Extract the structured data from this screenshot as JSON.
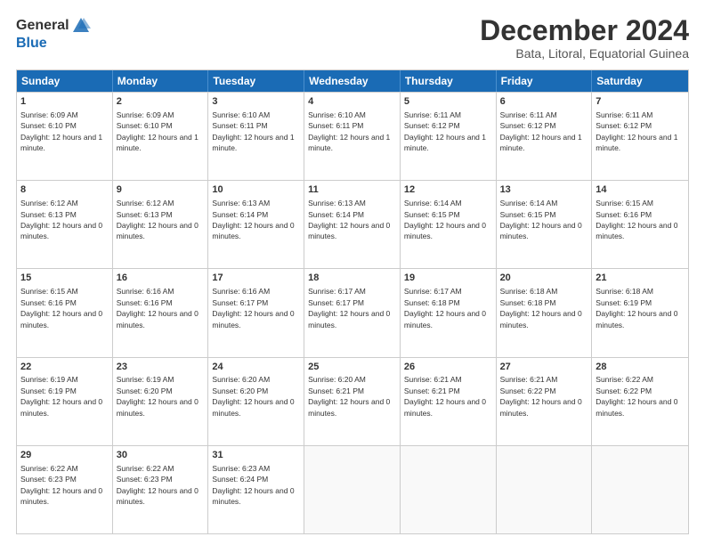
{
  "logo": {
    "general": "General",
    "blue": "Blue"
  },
  "title": "December 2024",
  "subtitle": "Bata, Litoral, Equatorial Guinea",
  "days": [
    "Sunday",
    "Monday",
    "Tuesday",
    "Wednesday",
    "Thursday",
    "Friday",
    "Saturday"
  ],
  "weeks": [
    [
      {
        "day": "1",
        "rise": "6:09 AM",
        "set": "6:10 PM",
        "daylight": "12 hours and 1 minute."
      },
      {
        "day": "2",
        "rise": "6:09 AM",
        "set": "6:10 PM",
        "daylight": "12 hours and 1 minute."
      },
      {
        "day": "3",
        "rise": "6:10 AM",
        "set": "6:11 PM",
        "daylight": "12 hours and 1 minute."
      },
      {
        "day": "4",
        "rise": "6:10 AM",
        "set": "6:11 PM",
        "daylight": "12 hours and 1 minute."
      },
      {
        "day": "5",
        "rise": "6:11 AM",
        "set": "6:12 PM",
        "daylight": "12 hours and 1 minute."
      },
      {
        "day": "6",
        "rise": "6:11 AM",
        "set": "6:12 PM",
        "daylight": "12 hours and 1 minute."
      },
      {
        "day": "7",
        "rise": "6:11 AM",
        "set": "6:12 PM",
        "daylight": "12 hours and 1 minute."
      }
    ],
    [
      {
        "day": "8",
        "rise": "6:12 AM",
        "set": "6:13 PM",
        "daylight": "12 hours and 0 minutes."
      },
      {
        "day": "9",
        "rise": "6:12 AM",
        "set": "6:13 PM",
        "daylight": "12 hours and 0 minutes."
      },
      {
        "day": "10",
        "rise": "6:13 AM",
        "set": "6:14 PM",
        "daylight": "12 hours and 0 minutes."
      },
      {
        "day": "11",
        "rise": "6:13 AM",
        "set": "6:14 PM",
        "daylight": "12 hours and 0 minutes."
      },
      {
        "day": "12",
        "rise": "6:14 AM",
        "set": "6:15 PM",
        "daylight": "12 hours and 0 minutes."
      },
      {
        "day": "13",
        "rise": "6:14 AM",
        "set": "6:15 PM",
        "daylight": "12 hours and 0 minutes."
      },
      {
        "day": "14",
        "rise": "6:15 AM",
        "set": "6:16 PM",
        "daylight": "12 hours and 0 minutes."
      }
    ],
    [
      {
        "day": "15",
        "rise": "6:15 AM",
        "set": "6:16 PM",
        "daylight": "12 hours and 0 minutes."
      },
      {
        "day": "16",
        "rise": "6:16 AM",
        "set": "6:16 PM",
        "daylight": "12 hours and 0 minutes."
      },
      {
        "day": "17",
        "rise": "6:16 AM",
        "set": "6:17 PM",
        "daylight": "12 hours and 0 minutes."
      },
      {
        "day": "18",
        "rise": "6:17 AM",
        "set": "6:17 PM",
        "daylight": "12 hours and 0 minutes."
      },
      {
        "day": "19",
        "rise": "6:17 AM",
        "set": "6:18 PM",
        "daylight": "12 hours and 0 minutes."
      },
      {
        "day": "20",
        "rise": "6:18 AM",
        "set": "6:18 PM",
        "daylight": "12 hours and 0 minutes."
      },
      {
        "day": "21",
        "rise": "6:18 AM",
        "set": "6:19 PM",
        "daylight": "12 hours and 0 minutes."
      }
    ],
    [
      {
        "day": "22",
        "rise": "6:19 AM",
        "set": "6:19 PM",
        "daylight": "12 hours and 0 minutes."
      },
      {
        "day": "23",
        "rise": "6:19 AM",
        "set": "6:20 PM",
        "daylight": "12 hours and 0 minutes."
      },
      {
        "day": "24",
        "rise": "6:20 AM",
        "set": "6:20 PM",
        "daylight": "12 hours and 0 minutes."
      },
      {
        "day": "25",
        "rise": "6:20 AM",
        "set": "6:21 PM",
        "daylight": "12 hours and 0 minutes."
      },
      {
        "day": "26",
        "rise": "6:21 AM",
        "set": "6:21 PM",
        "daylight": "12 hours and 0 minutes."
      },
      {
        "day": "27",
        "rise": "6:21 AM",
        "set": "6:22 PM",
        "daylight": "12 hours and 0 minutes."
      },
      {
        "day": "28",
        "rise": "6:22 AM",
        "set": "6:22 PM",
        "daylight": "12 hours and 0 minutes."
      }
    ],
    [
      {
        "day": "29",
        "rise": "6:22 AM",
        "set": "6:23 PM",
        "daylight": "12 hours and 0 minutes."
      },
      {
        "day": "30",
        "rise": "6:22 AM",
        "set": "6:23 PM",
        "daylight": "12 hours and 0 minutes."
      },
      {
        "day": "31",
        "rise": "6:23 AM",
        "set": "6:24 PM",
        "daylight": "12 hours and 0 minutes."
      },
      null,
      null,
      null,
      null
    ]
  ]
}
